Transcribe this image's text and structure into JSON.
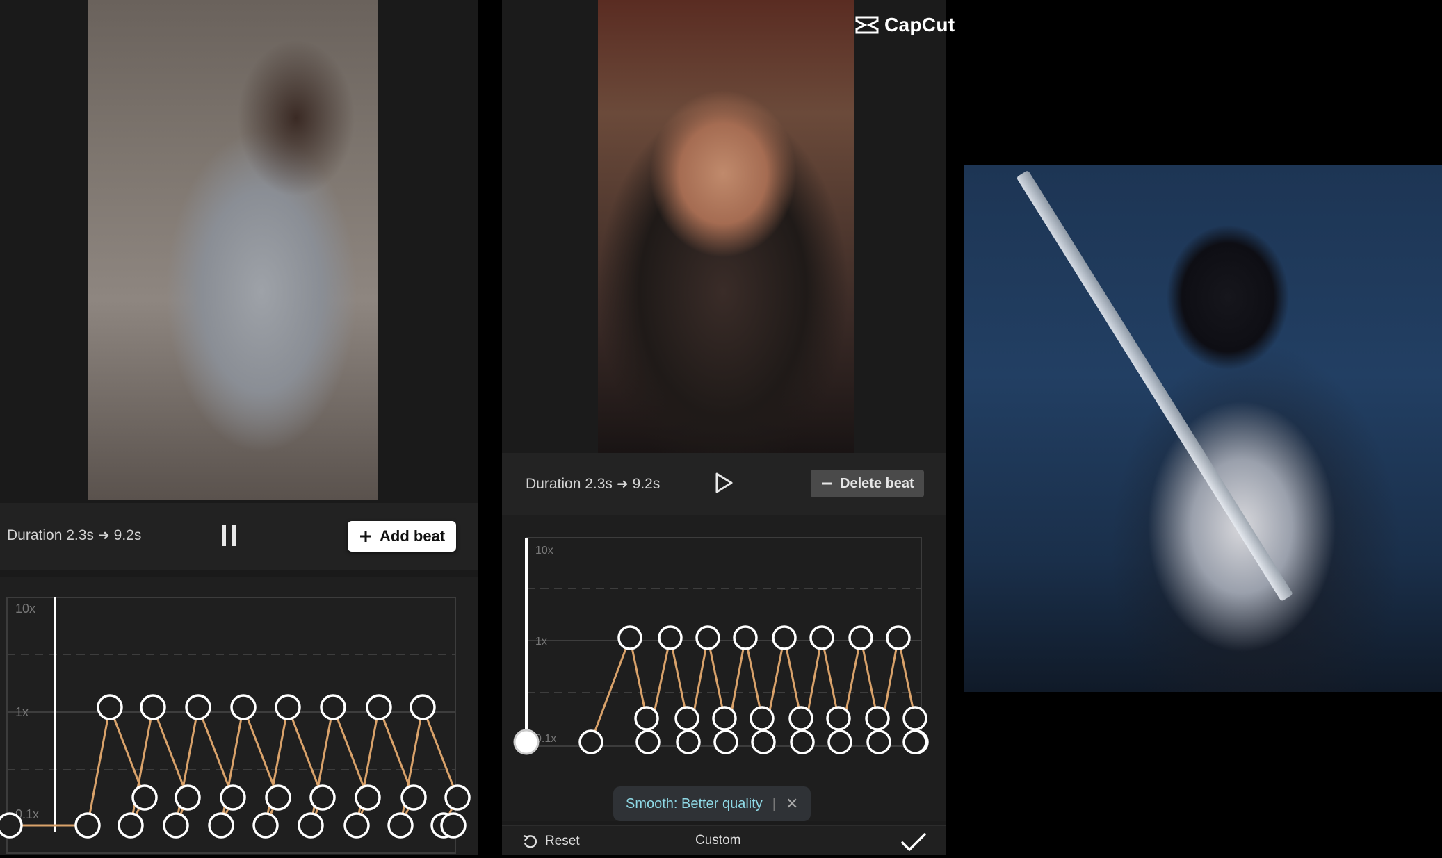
{
  "logo": {
    "text": "CapCut",
    "icon": "capcut-logo-icon"
  },
  "left": {
    "duration_label": "Duration 2.3s",
    "duration_arrow": "➜",
    "duration_value": "9.2s",
    "pause_icon": "pause-icon",
    "add_beat_icon": "plus-icon",
    "add_beat_label": "Add beat",
    "axis_labels": [
      "10x",
      "1x",
      "0.1x"
    ]
  },
  "middle": {
    "duration_label": "Duration 2.3s",
    "duration_arrow": "➜",
    "duration_value": "9.2s",
    "play_icon": "play-icon",
    "delete_beat_icon": "minus-icon",
    "delete_beat_label": "Delete beat",
    "axis_labels": [
      "10x",
      "1x",
      "0.1x"
    ],
    "smooth_label": "Smooth: Better quality",
    "smooth_sep": "|",
    "smooth_close_icon": "close-icon",
    "reset_icon": "reset-icon",
    "reset_label": "Reset",
    "title_label": "Custom",
    "confirm_icon": "check-icon"
  },
  "colors": {
    "accent_line": "#d9a26a",
    "node_stroke": "#ffffff",
    "smooth_text": "#8fd9e6"
  }
}
